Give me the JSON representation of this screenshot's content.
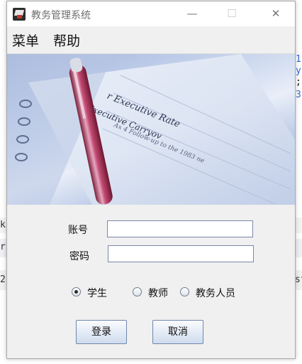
{
  "window": {
    "title": "教务管理系统",
    "controls": {
      "minimize": "—",
      "maximize": "☐",
      "close": "✕"
    }
  },
  "menubar": {
    "items": [
      "菜单",
      "帮助"
    ]
  },
  "banner": {
    "text_lines": [
      "r Executive Rate",
      "Executive Carryov",
      "Ax 4 Follow-up to the 1983 ne"
    ]
  },
  "form": {
    "account_label": "账号",
    "password_label": "密码",
    "account_value": "",
    "password_value": ""
  },
  "roles": {
    "options": [
      "学生",
      "教师",
      "教务人员"
    ],
    "selected": "学生"
  },
  "buttons": {
    "login": "登录",
    "cancel": "取消"
  },
  "background_fragments": [
    "k",
    "rk",
    "2",
    "st",
    "1",
    "y",
    ";",
    "3"
  ]
}
